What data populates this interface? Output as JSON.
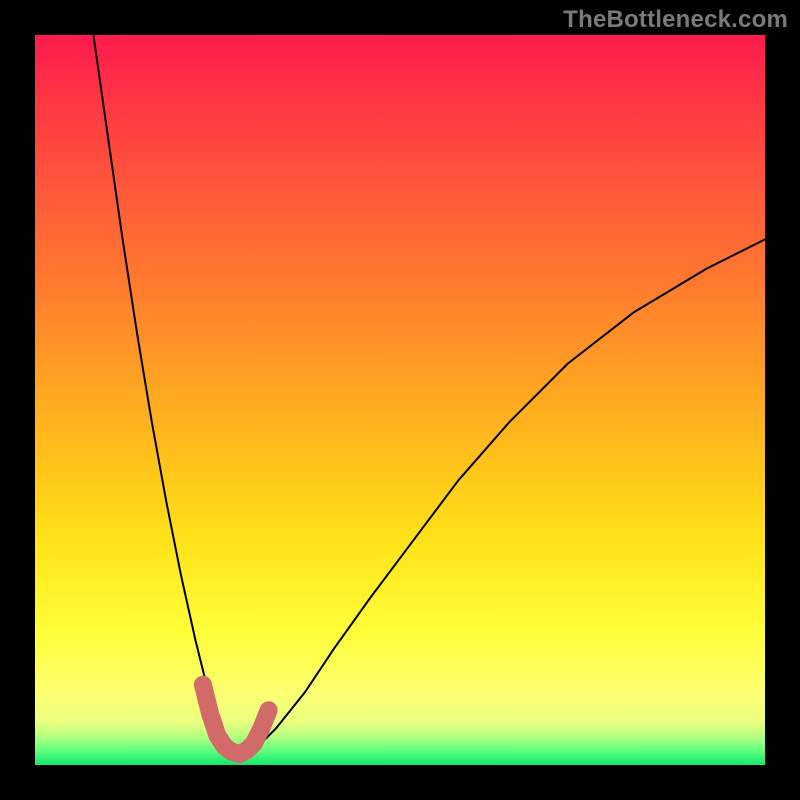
{
  "watermark": "TheBottleneck.com",
  "chart_data": {
    "type": "line",
    "title": "",
    "xlabel": "",
    "ylabel": "",
    "xlim": [
      0,
      100
    ],
    "ylim": [
      0,
      100
    ],
    "grid": false,
    "legend": false,
    "series": [
      {
        "name": "main-curve",
        "color": "#000000",
        "x": [
          8,
          10,
          12,
          14,
          16,
          18,
          20,
          22,
          23.5,
          25,
          26.5,
          28,
          30,
          33,
          37,
          41,
          46,
          52,
          58,
          65,
          73,
          82,
          92,
          100
        ],
        "y": [
          100,
          86,
          72,
          59,
          47,
          36,
          26,
          17,
          11,
          6,
          3,
          1.5,
          2,
          5,
          10,
          16,
          23,
          31,
          39,
          47,
          55,
          62,
          68,
          72
        ]
      },
      {
        "name": "valley-highlight",
        "color": "#d36a6a",
        "x": [
          23,
          24,
          25,
          26,
          27,
          28,
          29,
          30,
          31,
          32
        ],
        "y": [
          11,
          7,
          4,
          2.5,
          1.8,
          1.5,
          2,
          3,
          5,
          7.5
        ]
      }
    ]
  }
}
